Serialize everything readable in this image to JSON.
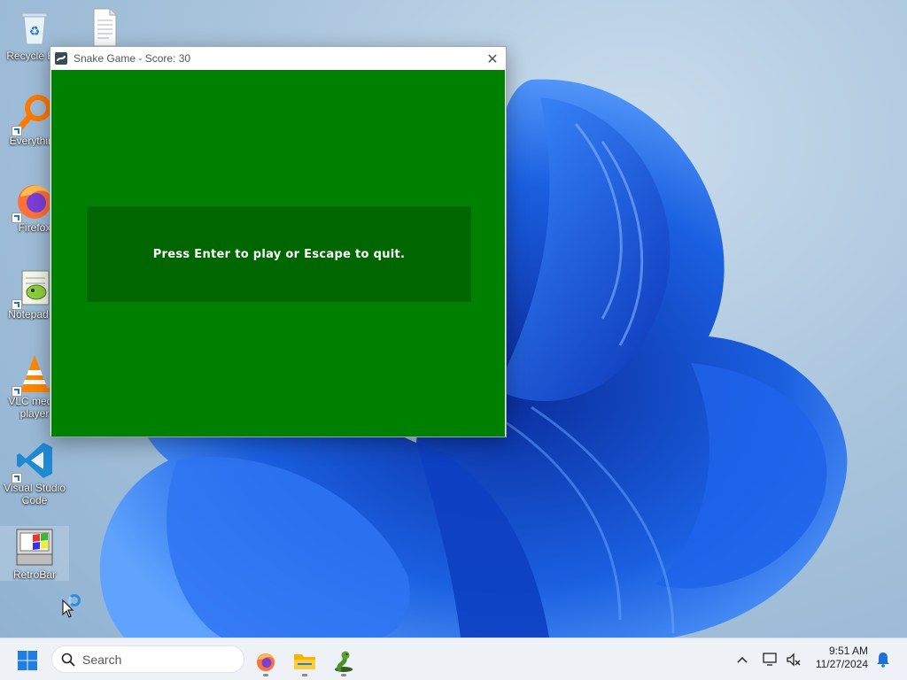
{
  "desktop": {
    "icons": [
      {
        "label": "Recycle Bin",
        "icon": "recycle-bin-icon"
      },
      {
        "label": "",
        "icon": "text-document-icon"
      },
      {
        "label": "Everything",
        "icon": "everything-search-icon"
      },
      {
        "label": "Firefox",
        "icon": "firefox-icon"
      },
      {
        "label": "Notepad++",
        "icon": "notepadpp-icon"
      },
      {
        "label": "VLC media player",
        "icon": "vlc-icon"
      },
      {
        "label": "Visual Studio Code",
        "icon": "vscode-icon"
      },
      {
        "label": "RetroBar",
        "icon": "retrobar-icon"
      }
    ]
  },
  "window": {
    "title": "Snake Game - Score: 30",
    "close_symbol": "✕",
    "message": "Press Enter to play or Escape to quit.",
    "colors": {
      "field": "#008000",
      "message_panel": "#006600",
      "text": "#ffffff"
    }
  },
  "taskbar": {
    "search_placeholder": "Search",
    "apps": [
      "firefox-icon",
      "file-explorer-icon",
      "snake-game-icon"
    ],
    "time": "9:51 AM",
    "date": "11/27/2024"
  }
}
